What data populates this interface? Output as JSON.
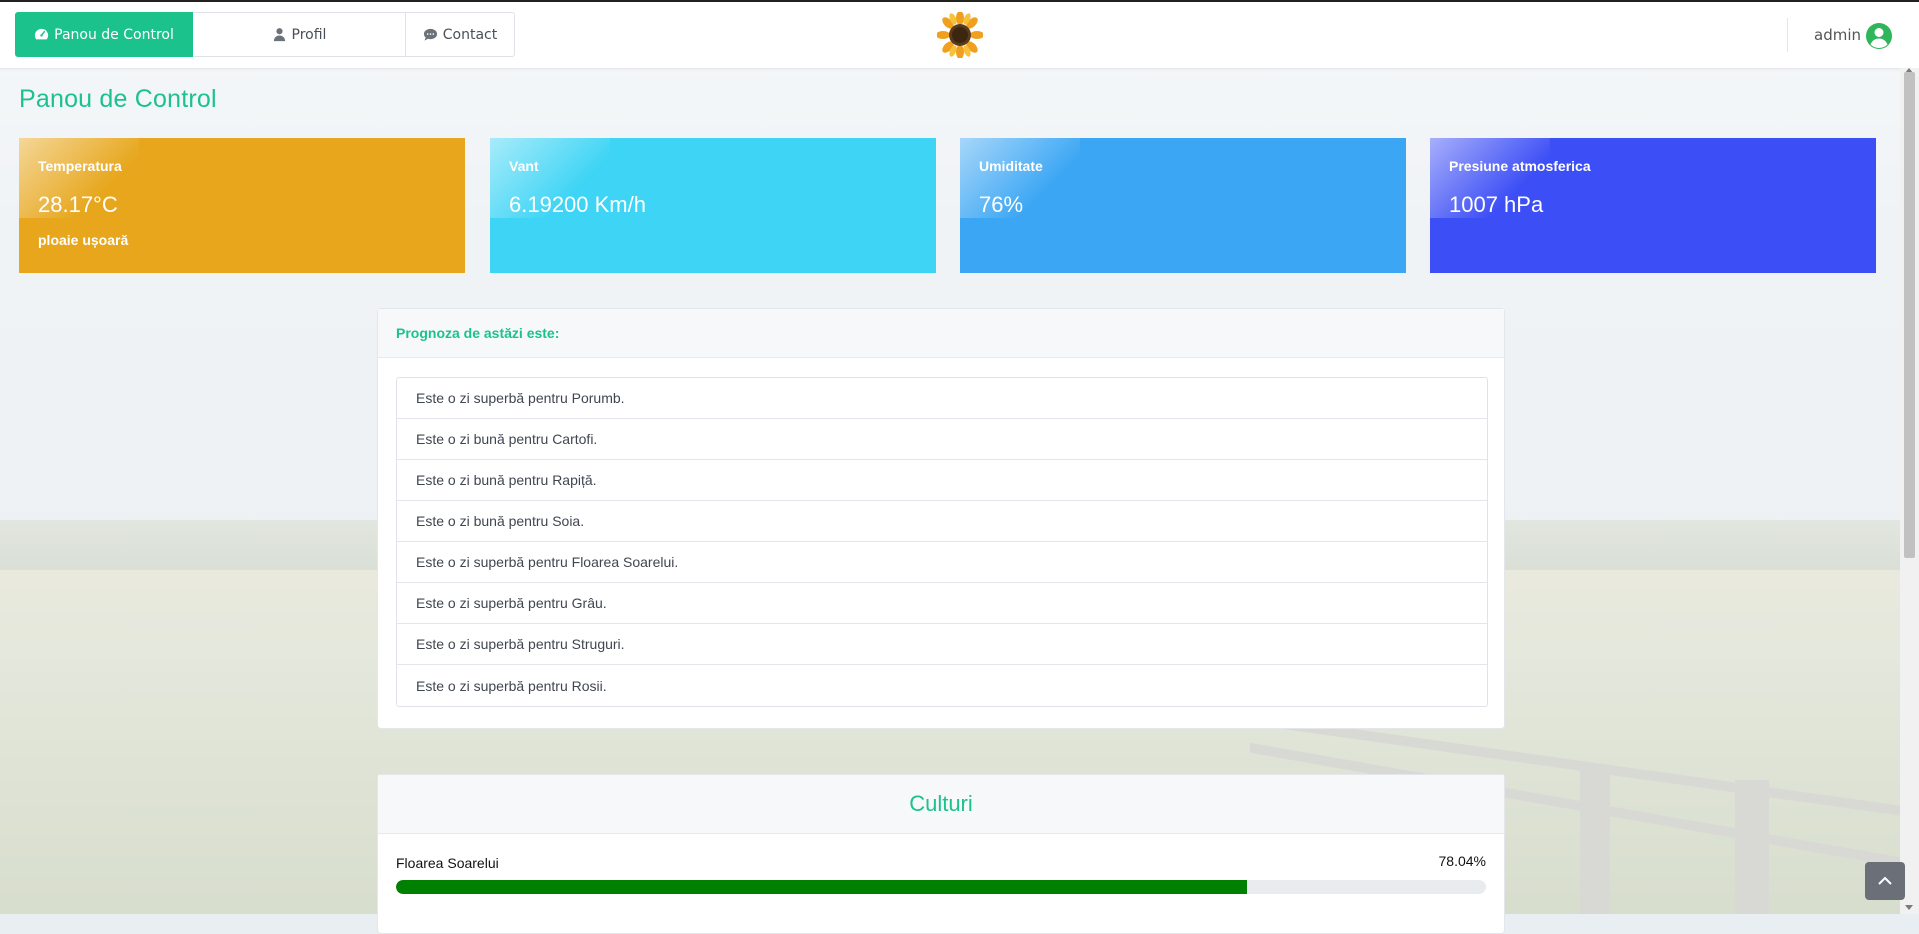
{
  "nav": {
    "tabs": [
      {
        "label": "Panou de Control",
        "icon": "dashboard-icon",
        "active": true
      },
      {
        "label": "Profil",
        "icon": "user-icon",
        "active": false
      },
      {
        "label": "Contact",
        "icon": "chat-icon",
        "active": false
      }
    ],
    "logo": "sunflower-logo",
    "user": "admin",
    "avatar_icon": "user-circle-icon"
  },
  "page": {
    "title": "Panou de Control"
  },
  "cards": [
    {
      "title": "Temperatura",
      "value": "28.17°C",
      "sub": "ploaie ușoară",
      "color": "#e7a61b"
    },
    {
      "title": "Vant",
      "value": "6.19200 Km/h",
      "sub": "",
      "color": "#3dd4f5"
    },
    {
      "title": "Umiditate",
      "value": "76%",
      "sub": "",
      "color": "#3ba6f4"
    },
    {
      "title": "Presiune atmosferica",
      "value": "1007 hPa",
      "sub": "",
      "color": "#3c4ef6"
    }
  ],
  "forecast": {
    "heading": "Prognoza de astăzi este:",
    "items": [
      "Este o zi superbă pentru Porumb.",
      "Este o zi bună pentru Cartofi.",
      "Este o zi bună pentru Rapiță.",
      "Este o zi bună pentru Soia.",
      "Este o zi superbă pentru Floarea Soarelui.",
      "Este o zi superbă pentru Grâu.",
      "Este o zi superbă pentru Struguri.",
      "Este o zi superbă pentru Rosii."
    ]
  },
  "crops": {
    "heading": "Culturi",
    "items": [
      {
        "name": "Floarea Soarelui",
        "percent_label": "78.04%",
        "percent": 78.04,
        "color": "#008000"
      }
    ]
  },
  "colors": {
    "accent": "#1cc28c"
  }
}
